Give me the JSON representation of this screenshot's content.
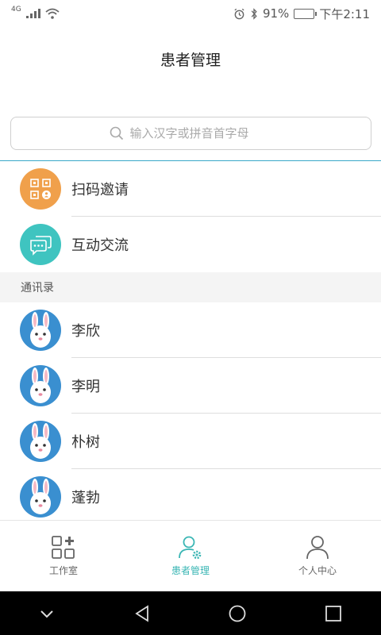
{
  "status_bar": {
    "network": "4G",
    "battery_percent": "91%",
    "battery_level": 0.91,
    "time": "下午2:11"
  },
  "header": {
    "title": "患者管理"
  },
  "search": {
    "placeholder": "输入汉字或拼音首字母"
  },
  "actions": [
    {
      "label": "扫码邀请",
      "icon": "qr-invite-icon",
      "color": "#f0a04b"
    },
    {
      "label": "互动交流",
      "icon": "chat-bubble-icon",
      "color": "#3fc4c0"
    }
  ],
  "contacts_section": {
    "title": "通讯录"
  },
  "contacts": [
    {
      "name": "李欣",
      "avatar": "rabbit-avatar-icon"
    },
    {
      "name": "李明",
      "avatar": "rabbit-avatar-icon"
    },
    {
      "name": "朴树",
      "avatar": "rabbit-avatar-icon"
    },
    {
      "name": "蓬勃",
      "avatar": "rabbit-avatar-icon"
    }
  ],
  "tabs": [
    {
      "label": "工作室",
      "icon": "grid-plus-icon",
      "active": false
    },
    {
      "label": "患者管理",
      "icon": "user-gear-icon",
      "active": true
    },
    {
      "label": "个人中心",
      "icon": "person-icon",
      "active": false
    }
  ],
  "colors": {
    "accent": "#3ab6b4",
    "divider": "#3aa8c8",
    "avatar_bg": "#3a8fd0"
  }
}
